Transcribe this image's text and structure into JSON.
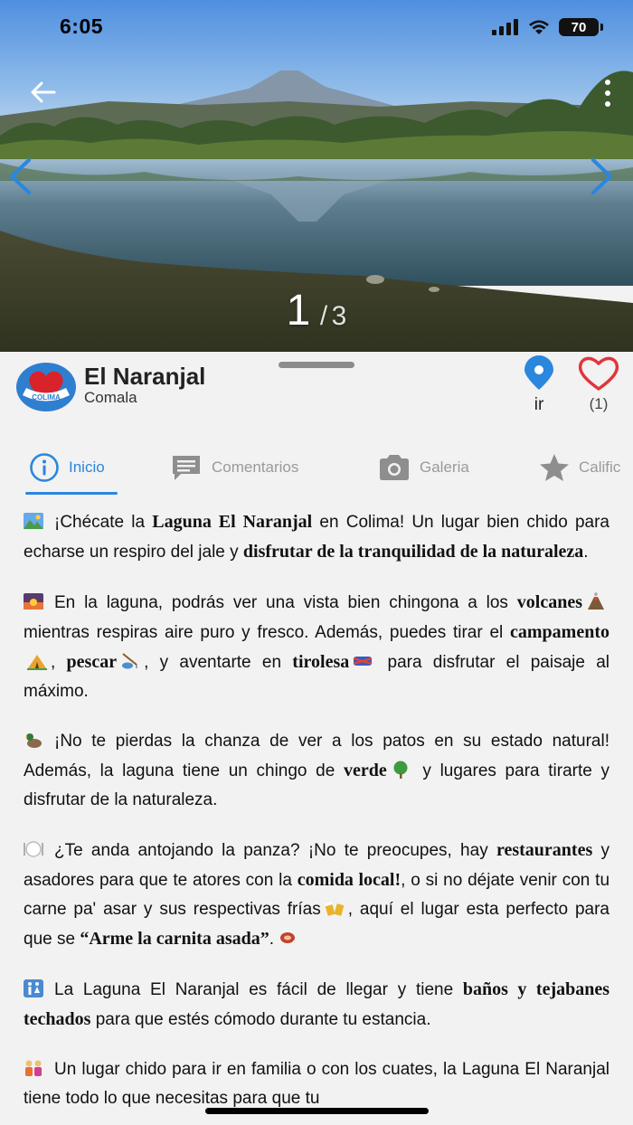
{
  "status_bar": {
    "time": "6:05",
    "battery": "70"
  },
  "gallery": {
    "current": "1",
    "separator": "/",
    "total": "3"
  },
  "place": {
    "title": "El Naranjal",
    "subtitle": "Comala",
    "logo_text": "COLIMA"
  },
  "actions": {
    "go_label": "ir",
    "favorites_count": "(1)"
  },
  "tabs": [
    {
      "label": "Inicio",
      "icon": "info-icon",
      "active": true
    },
    {
      "label": "Comentarios",
      "icon": "comment-icon",
      "active": false
    },
    {
      "label": "Galeria",
      "icon": "camera-icon",
      "active": false
    },
    {
      "label": "Calific",
      "icon": "star-icon",
      "active": false
    }
  ],
  "content": {
    "p1": {
      "a": "¡Chécate la",
      "b1": "Laguna El Naranjal",
      "c": "en Colima! Un lugar bien chido para echarse un respiro del jale y",
      "b2": "disfrutar de la tranquilidad de la naturaleza",
      "d": "."
    },
    "p2": {
      "a": "En la laguna, podrás ver una vista bien chingona a los",
      "b1": "volcanes",
      "c": "mientras respiras aire puro y fresco. Además, puedes tirar el",
      "b2": "campamento",
      "d": ",",
      "b3": "pescar",
      "e": ", y aventarte en",
      "b4": "tirolesa",
      "f": "para disfrutar el paisaje al máximo."
    },
    "p3": {
      "a": "¡No te pierdas la chanza de ver a los patos en su estado natural! Además, la laguna tiene un chingo de",
      "b1": "verde",
      "c": "y lugares para tirarte y disfrutar de la naturaleza."
    },
    "p4": {
      "a": "¿Te anda antojando la panza? ¡No te preocupes, hay",
      "b1": "restaurantes",
      "c": "y asadores para que te atores con la",
      "b2": "comida local!",
      "d": ", o si no déjate venir con tu carne pa' asar y sus respectivas frías",
      "e": ", aquí el lugar esta perfecto para que se",
      "b3": "“Arme la carnita asada”",
      "f": "."
    },
    "p5": {
      "a": "La Laguna El Naranjal es fácil de llegar y tiene",
      "b1": "baños y tejabanes techados",
      "c": "para que estés cómodo durante tu estancia."
    },
    "p6": {
      "a": "Un lugar chido para ir en familia o con los cuates, la Laguna El Naranjal tiene todo lo que necesitas para que tu"
    }
  },
  "colors": {
    "accent": "#2b86de",
    "heart": "#e0353b",
    "pin": "#2b86de"
  },
  "icons": [
    "back-arrow-icon",
    "more-vert-icon",
    "chevron-left-icon",
    "chevron-right-icon",
    "map-pin-icon",
    "heart-outline-icon",
    "signal-icon",
    "wifi-icon",
    "battery-icon"
  ]
}
